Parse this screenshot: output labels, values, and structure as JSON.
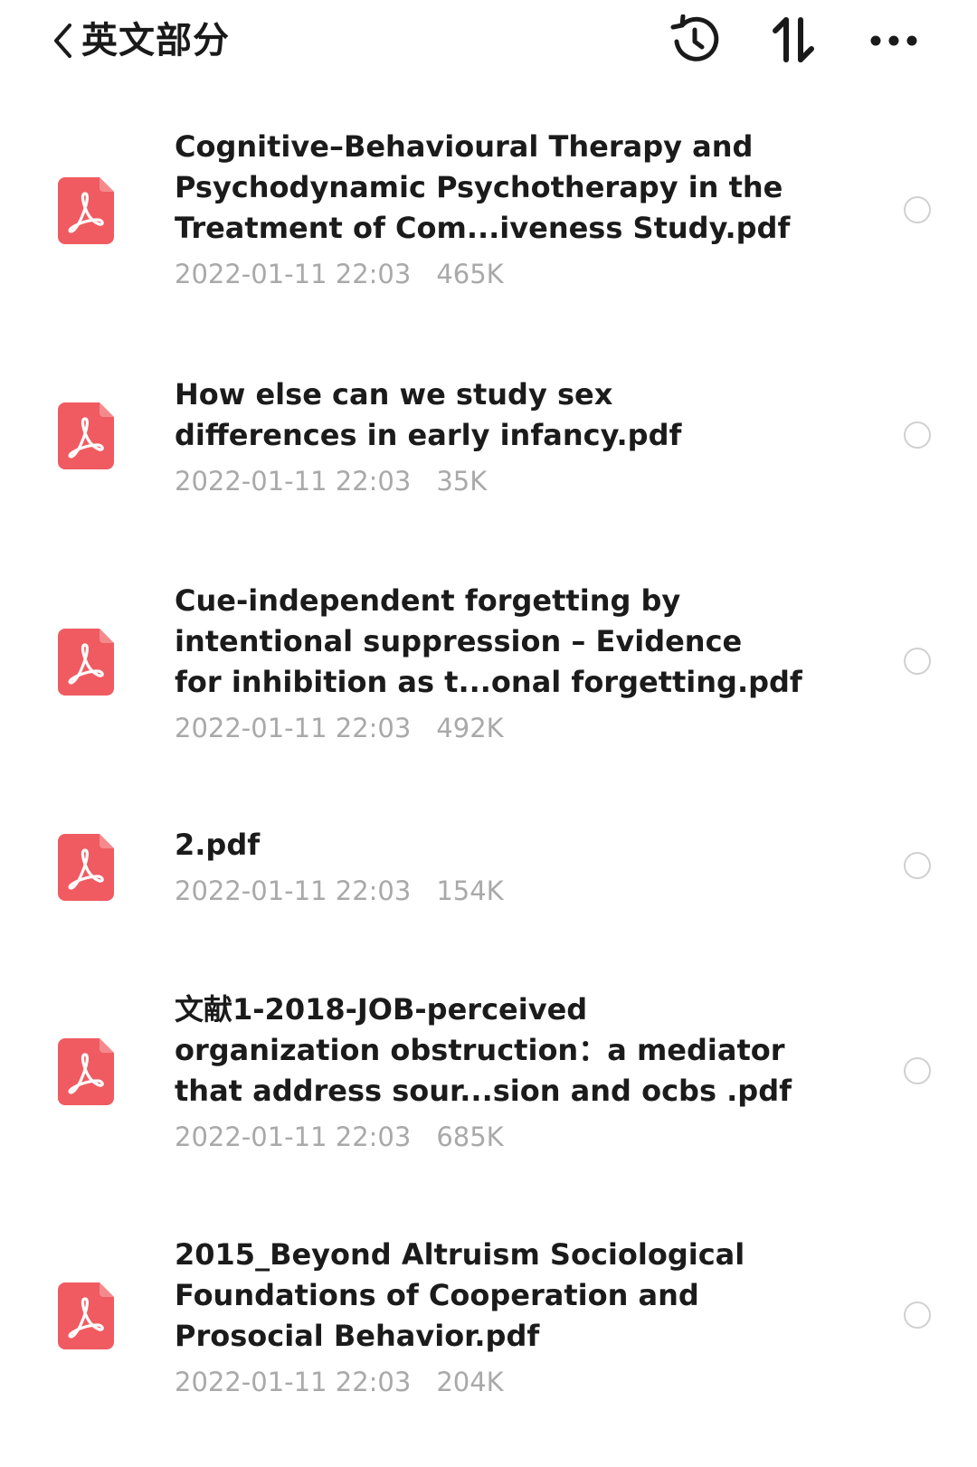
{
  "header": {
    "title": "英文部分",
    "icons": {
      "back": "chevron-left-icon",
      "history": "history-icon",
      "sort": "sort-icon",
      "more": "more-icon"
    }
  },
  "files": [
    {
      "name": "Cognitive–Behavioural Therapy and\nPsychodynamic Psychotherapy in the\nTreatment of Com...iveness Study.pdf",
      "date": "2022-01-11 22:03",
      "size": "465K",
      "icon": "pdf-icon",
      "selected": false
    },
    {
      "name": "How else can we study sex\ndifferences in early infancy.pdf",
      "date": "2022-01-11 22:03",
      "size": "35K",
      "icon": "pdf-icon",
      "selected": false
    },
    {
      "name": "Cue-independent forgetting by\nintentional suppression – Evidence\nfor inhibition as t...onal forgetting.pdf",
      "date": "2022-01-11 22:03",
      "size": "492K",
      "icon": "pdf-icon",
      "selected": false
    },
    {
      "name": "2.pdf",
      "date": "2022-01-11 22:03",
      "size": "154K",
      "icon": "pdf-icon",
      "selected": false
    },
    {
      "name": "文献1-2018-JOB-perceived\norganization obstruction：a mediator\nthat address sour...sion and ocbs .pdf",
      "date": "2022-01-11 22:03",
      "size": "685K",
      "icon": "pdf-icon",
      "selected": false
    },
    {
      "name": "2015_Beyond Altruism Sociological\nFoundations of Cooperation and\nProsocial Behavior.pdf",
      "date": "2022-01-11 22:03",
      "size": "204K",
      "icon": "pdf-icon",
      "selected": false
    }
  ],
  "colors": {
    "pdf_icon": "#f05b61",
    "meta_text": "#a9a9a9",
    "circle_border": "#d0d0d0"
  }
}
